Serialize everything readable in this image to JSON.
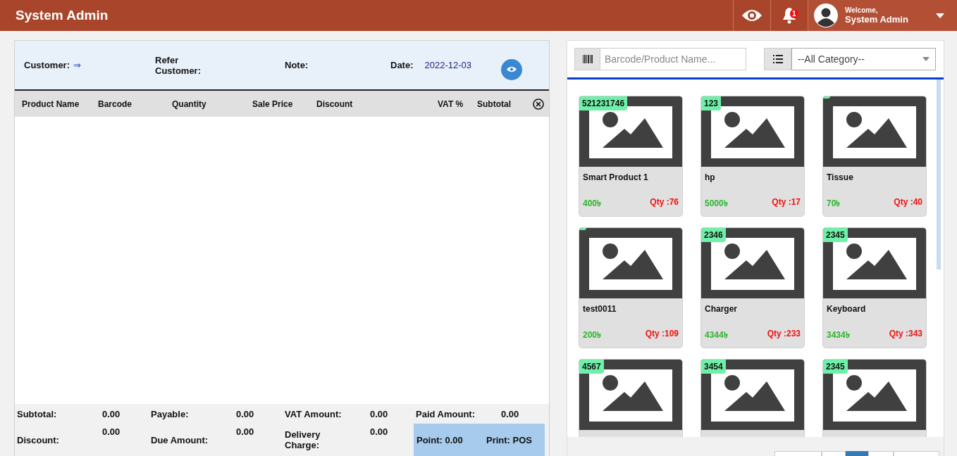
{
  "header": {
    "title": "System Admin",
    "notification_count": "1",
    "welcome": "Welcome,",
    "user_name": "System Admin"
  },
  "sale_info": {
    "customer_label": "Customer:",
    "customer_arrow": "⇒",
    "refer_label": "Refer Customer:",
    "note_label": "Note:",
    "date_label": "Date:",
    "date_value": "2022-12-03"
  },
  "table": {
    "columns": [
      "Product Name",
      "Barcode",
      "Quantity",
      "Sale Price",
      "Discount",
      "VAT %",
      "Subtotal"
    ]
  },
  "summary": [
    {
      "label": "Subtotal:",
      "value": "0.00"
    },
    {
      "label": "Payable:",
      "value": "0.00"
    },
    {
      "label": "VAT Amount:",
      "value": "0.00"
    },
    {
      "label": "Paid Amount:",
      "value": "0.00"
    },
    {
      "label": "Discount:",
      "value": "0.00"
    },
    {
      "label": "Due Amount:",
      "value": "0.00"
    },
    {
      "label": "Delivery Charge:",
      "value": "0.00"
    }
  ],
  "point": "Point: 0.00",
  "print": "Print: POS",
  "search": {
    "placeholder": "Barcode/Product Name..."
  },
  "category": {
    "value": "--All Category--"
  },
  "products": [
    {
      "barcode": "521231746",
      "name": "Smart Product 1",
      "price": "400৳",
      "qty": "Qty :76"
    },
    {
      "barcode": "123",
      "name": "hp",
      "price": "5000৳",
      "qty": "Qty :17"
    },
    {
      "name": "Tissue",
      "price": "70৳",
      "qty": "Qty :40"
    },
    {
      "name": "test0011",
      "price": "200৳",
      "qty": "Qty :109"
    },
    {
      "barcode": "2346",
      "name": "Charger",
      "price": "4344৳",
      "qty": "Qty :233"
    },
    {
      "barcode": "2345",
      "name": "Keyboard",
      "price": "3434৳",
      "qty": "Qty :343"
    },
    {
      "barcode": "4567"
    },
    {
      "barcode": "3454"
    },
    {
      "barcode": "2345"
    }
  ],
  "pagination": [
    {
      "selected": false
    },
    {
      "selected": false
    },
    {
      "selected": true
    },
    {
      "selected": false
    },
    {
      "selected": false
    }
  ]
}
